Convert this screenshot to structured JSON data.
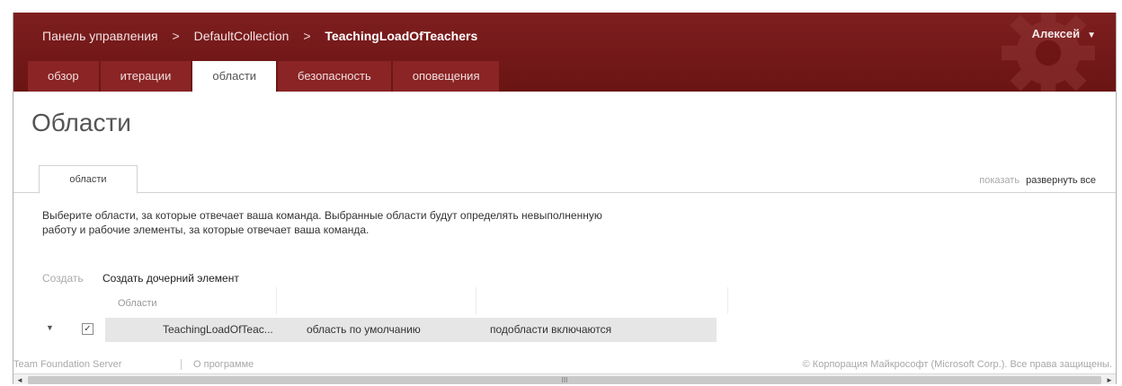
{
  "header": {
    "breadcrumb": [
      "Панель управления",
      "DefaultCollection",
      "TeachingLoadOfTeachers"
    ],
    "separator": ">",
    "user": "Алексей",
    "user_caret": "▼",
    "gear_icon": "gear-icon"
  },
  "tabs": [
    {
      "label": "обзор",
      "active": false
    },
    {
      "label": "итерации",
      "active": false
    },
    {
      "label": "области",
      "active": true
    },
    {
      "label": "безопасность",
      "active": false
    },
    {
      "label": "оповещения",
      "active": false
    }
  ],
  "page": {
    "title": "Области",
    "subtab": "области",
    "show_label": "показать",
    "expand_all": "развернуть все",
    "description": "Выберите области, за которые отвечает ваша команда. Выбранные области будут определять невыполненную работу и рабочие элементы, за которые отвечает ваша команда.",
    "create": "Создать",
    "create_child": "Создать дочерний элемент"
  },
  "grid": {
    "column_header": "Области",
    "rows": [
      {
        "expander": "▼",
        "checked": true,
        "checkmark": "✓",
        "name": "TeachingLoadOfTeac...",
        "default_label": "область по умолчанию",
        "subareas_label": "подобласти включаются"
      }
    ]
  },
  "footer": {
    "product": "Team Foundation Server",
    "about": "О программе",
    "copyright": "© Корпорация Майкрософт (Microsoft Corp.). Все права защищены."
  },
  "scrollbar": {
    "left_arrow": "◄",
    "right_arrow": "►",
    "grip": "III"
  },
  "colors": {
    "header_bg": "#6a1414",
    "tab_bg": "#8a2425",
    "row_bg": "#e6e6e6"
  }
}
